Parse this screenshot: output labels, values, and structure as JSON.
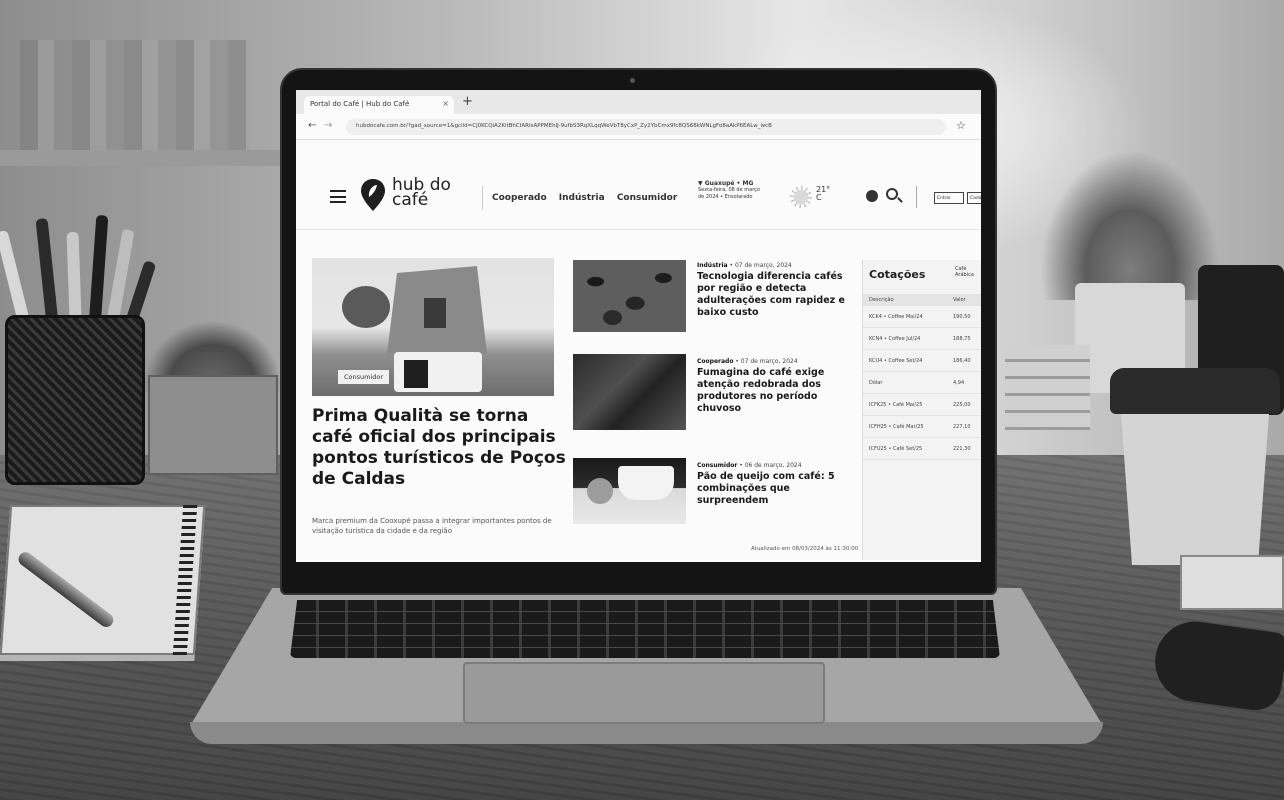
{
  "browser": {
    "tab_title": "Portal do Café | Hub do Café",
    "tab_close": "×",
    "new_tab": "+",
    "back": "←",
    "forward": "→",
    "url": "hubdocafe.com.br/?gad_source=1&gclid=Cj0KCQiA2KitBhCIARIsAPPMEhIJ-9ufbS3RqXLqqWeVbT8yCxP_Zy2YbCmx9fc8QS68kWNLgFo8aAkP6EALw_wcB",
    "bookmark_icon": "☆"
  },
  "site": {
    "logo_text": "hub do café",
    "nav": [
      "Cooperado",
      "Indústria",
      "Consumidor"
    ],
    "weather": {
      "location": "▼ Guaxupé • MG",
      "line1": "Sexta-feira, 08 de março",
      "line2": "de 2024 • Ensolarado",
      "temp": "21°",
      "temp_sub": "C"
    },
    "buttons": [
      "Entrar",
      "Cadastro"
    ]
  },
  "hero": {
    "badge": "Consumidor",
    "title": "Prima Qualità se torna café oficial dos principais pontos turísticos de Poços de Caldas",
    "subtitle": "Marca premium da Cooxupé passa a integrar importantes pontos de visitação turística da cidade e da região"
  },
  "stories": [
    {
      "category": "Indústria",
      "date": "• 07 de março, 2024",
      "title": "Tecnologia diferencia cafés por região e detecta adulterações com rapidez e baixo custo"
    },
    {
      "category": "Cooperado",
      "date": "• 07 de março, 2024",
      "title": "Fumagina do café exige atenção redobrada dos produtores no período chuvoso"
    },
    {
      "category": "Consumidor",
      "date": "• 06 de março, 2024",
      "title": "Pão de queijo com café: 5 combinações que surpreendem"
    }
  ],
  "quotes": {
    "title": "Cotações",
    "tab": "Café Arábica",
    "head": [
      "Descrição",
      "Valor"
    ],
    "rows": [
      [
        "KCK4 • Coffee Mai/24",
        "190,50"
      ],
      [
        "KCN4 • Coffee Jul/24",
        "188,75"
      ],
      [
        "KCU4 • Coffee Set/24",
        "186,40"
      ],
      [
        "Dólar",
        "4,94"
      ],
      [
        "ICFK25 • Café Mai/25",
        "225,00"
      ],
      [
        "ICFH25 • Café Mar/25",
        "227,10"
      ],
      [
        "ICFU25 • Café Set/25",
        "221,30"
      ]
    ],
    "updated": "Atualizado em 08/03/2024 às 11:30:00"
  }
}
